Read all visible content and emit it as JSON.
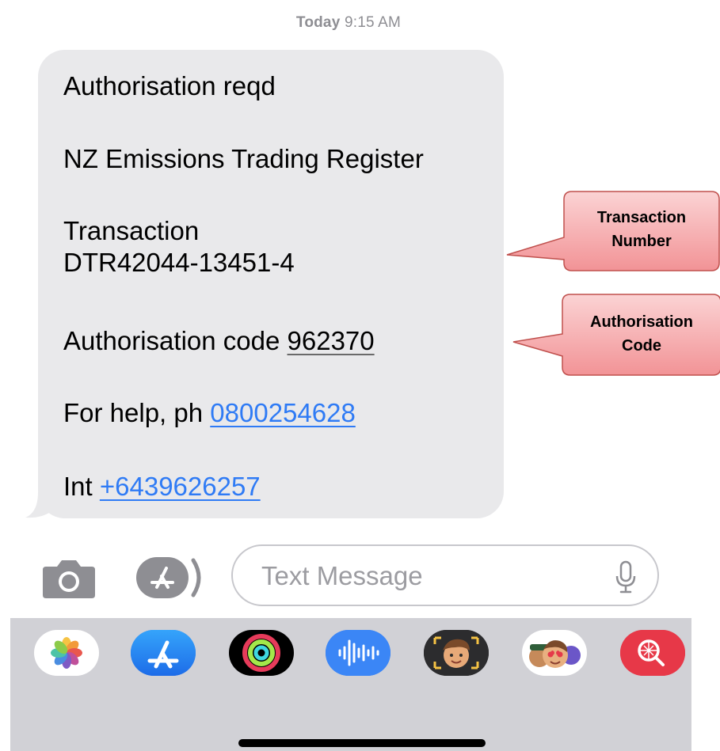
{
  "header": {
    "timestamp_day": "Today",
    "timestamp_time": "9:15 AM"
  },
  "message": {
    "line1": "Authorisation reqd",
    "line2": "NZ Emissions Trading Register",
    "line3": "Transaction",
    "line4": "DTR42044-13451-4",
    "auth_prefix": "Authorisation code ",
    "auth_code": "962370",
    "help_prefix": "For help, ph ",
    "help_phone": "0800254628",
    "int_prefix": "Int ",
    "int_phone": "+6439626257"
  },
  "callouts": {
    "transaction": {
      "line1": "Transaction",
      "line2": "Number"
    },
    "authorisation": {
      "line1": "Authorisation",
      "line2": "Code"
    }
  },
  "composer": {
    "placeholder": "Text Message",
    "camera_icon": "camera-icon",
    "apps_icon": "app-store-icon",
    "mic_icon": "microphone-icon"
  },
  "app_tray": {
    "icons": [
      "photos-app-icon",
      "app-store-app-icon",
      "activity-app-icon",
      "audio-message-app-icon",
      "memoji-app-icon",
      "memoji-stickers-app-icon",
      "image-search-app-icon"
    ]
  },
  "colors": {
    "bubble": "#e9e9eb",
    "link": "#2f7bf5",
    "callout_fill": "#f4a7aa",
    "callout_stroke": "#c0504d",
    "tray": "#d1d1d6"
  }
}
